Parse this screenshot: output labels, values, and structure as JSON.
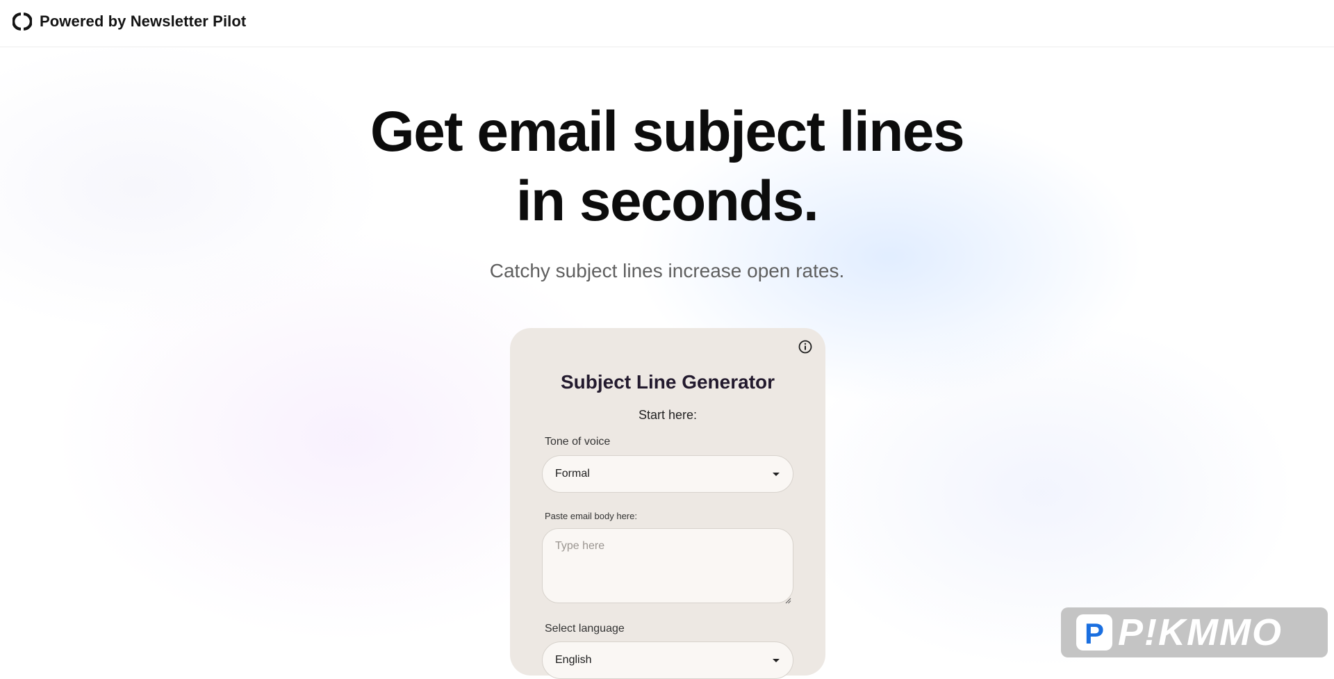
{
  "header": {
    "brand_text": "Powered by Newsletter Pilot",
    "logo_icon": "circle-brackets-icon"
  },
  "hero": {
    "title_line1": "Get email subject lines",
    "title_line2": "in seconds.",
    "subtitle": "Catchy subject lines increase open rates."
  },
  "card": {
    "info_icon": "info-icon",
    "title": "Subject Line Generator",
    "start_text": "Start here:",
    "tone": {
      "label": "Tone of voice",
      "value": "Formal"
    },
    "email_body": {
      "label": "Paste email body here:",
      "placeholder": "Type here",
      "value": ""
    },
    "language": {
      "label": "Select language",
      "value": "English"
    },
    "background_color": "#ede8e3",
    "field_color": "#faf7f4"
  },
  "watermark": {
    "text": "P!KMMO",
    "logo_letter": "P",
    "logo_color": "#1a6fe0"
  }
}
